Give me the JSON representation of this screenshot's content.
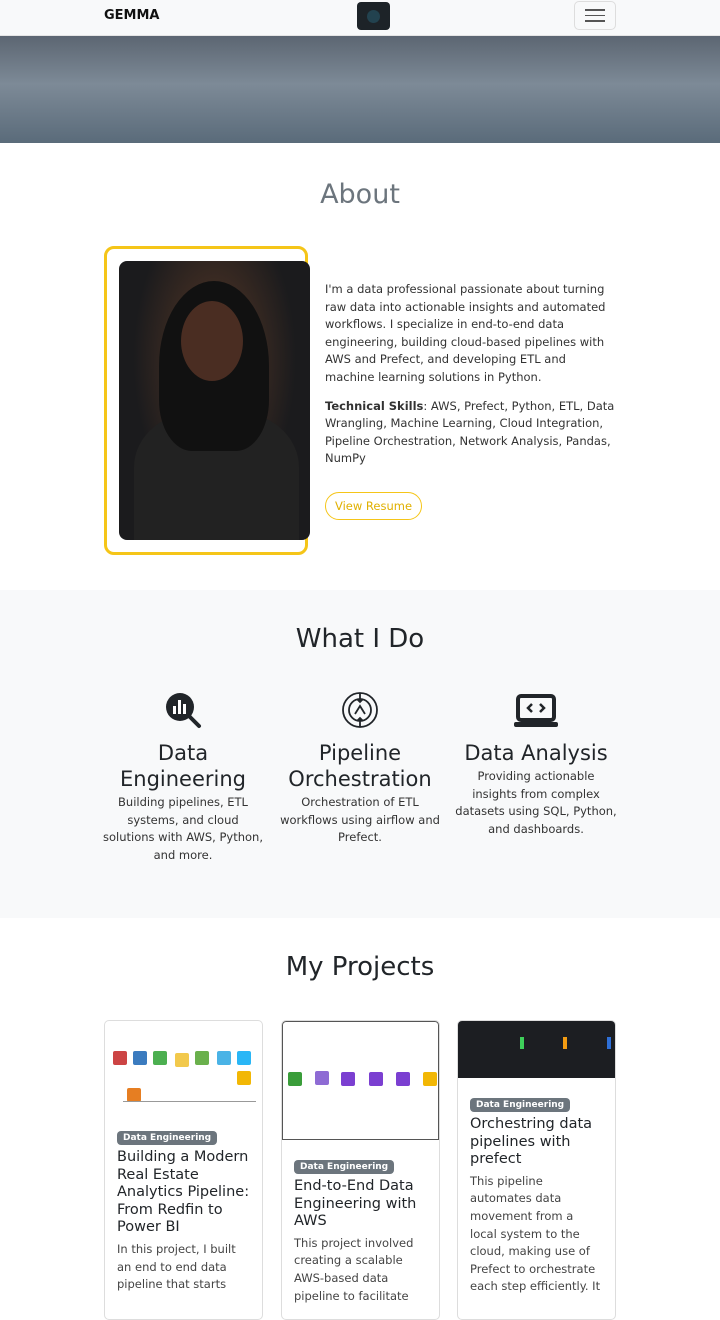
{
  "nav": {
    "brand": "GEMMA",
    "menu_icon": "hamburger-icon"
  },
  "about": {
    "title": "About",
    "bio": "I'm a data professional passionate about turning raw data into actionable insights and automated workflows. I specialize in end-to-end data engineering, building cloud-based pipelines with AWS and Prefect, and developing ETL and machine learning solutions in Python.",
    "skills_label": "Technical Skills",
    "skills": ": AWS, Prefect, Python, ETL, Data Wrangling, Machine Learning, Cloud Integration, Pipeline Orchestration, Network Analysis, Pandas, NumPy",
    "resume_button": "View Resume",
    "accent": "#f5c518"
  },
  "services": {
    "title": "What I Do",
    "items": [
      {
        "icon": "chart-magnifier-icon",
        "title": "Data Engineering",
        "desc": "Building pipelines, ETL systems, and cloud solutions with AWS, Python, and more."
      },
      {
        "icon": "sync-arrows-icon",
        "title": "Pipeline Orchestration",
        "desc": "Orchestration of ETL workflows using airflow and Prefect."
      },
      {
        "icon": "laptop-code-icon",
        "title": "Data Analysis",
        "desc": "Providing actionable insights from complex datasets using SQL, Python, and dashboards."
      }
    ]
  },
  "projects": {
    "title": "My Projects",
    "items": [
      {
        "badge": "Data Engineering",
        "title": "Building a Modern Real Estate Analytics Pipeline: From Redfin to Power BI",
        "desc": "In this project, I built an end to end data pipeline that starts"
      },
      {
        "badge": "Data Engineering",
        "title": "End-to-End Data Engineering with AWS",
        "desc": "This project involved creating a scalable AWS-based data pipeline to facilitate"
      },
      {
        "badge": "Data Engineering",
        "title": "Orchestring data pipelines with prefect",
        "desc": "This pipeline automates data movement from a local system to the cloud, making use of Prefect to orchestrate each step efficiently. It"
      }
    ]
  }
}
